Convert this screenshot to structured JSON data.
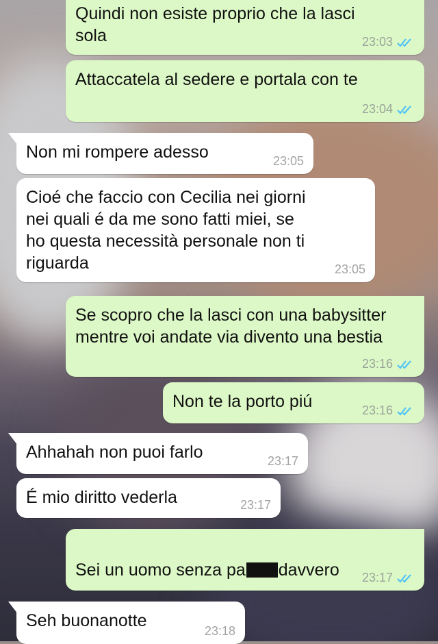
{
  "messages": [
    {
      "dir": "out",
      "text": "Quindi non esiste proprio che la lasci\nsola",
      "time": "23:03"
    },
    {
      "dir": "out",
      "text": "Attaccatela al sedere e portala con te",
      "time": "23:04"
    },
    {
      "dir": "in",
      "text": "Non mi rompere adesso",
      "time": "23:05"
    },
    {
      "dir": "in",
      "text": "Cioé che faccio con Cecilia nei giorni\nnei quali é da me sono fatti miei, se\nho  questa necessità personale non ti\nriguarda",
      "time": "23:05"
    },
    {
      "dir": "out",
      "text": "Se scopro che la lasci con una babysitter\nmentre voi andate via divento una bestia",
      "time": "23:16"
    },
    {
      "dir": "out",
      "text": "Non te la porto piú",
      "time": "23:16"
    },
    {
      "dir": "in",
      "text": "Ahhahah non puoi farlo",
      "time": "23:17"
    },
    {
      "dir": "in",
      "text": "É mio diritto vederla",
      "time": "23:17"
    },
    {
      "dir": "out",
      "text_before": "Sei un uomo senza pa",
      "text_after": "davvero",
      "time": "23:17"
    },
    {
      "dir": "in",
      "text": "Seh buonanotte",
      "time": "23:18"
    }
  ],
  "colors": {
    "outgoing_bubble": "#dcf8c6",
    "incoming_bubble": "#ffffff",
    "read_ticks": "#4fc3f7"
  },
  "icons": {
    "read_status": "double-check-icon"
  }
}
